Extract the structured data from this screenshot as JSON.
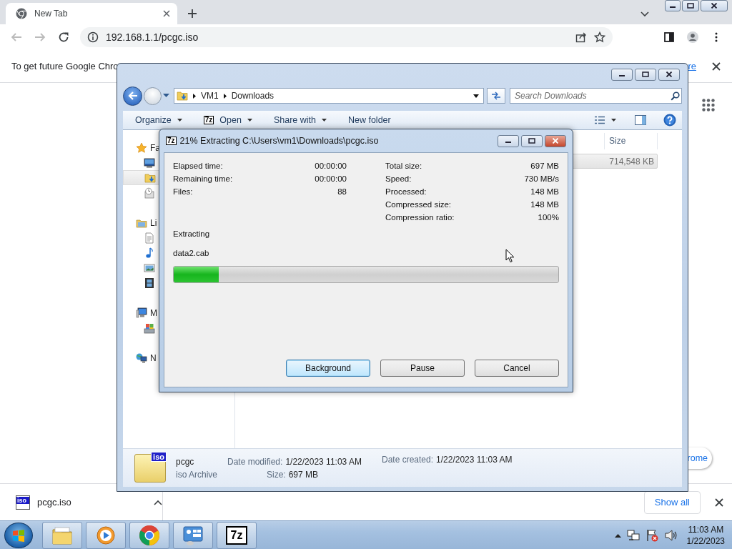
{
  "browser": {
    "tab": {
      "title": "New Tab",
      "selected": true
    },
    "url": "192.168.1.1/pcgc.iso",
    "infobar": {
      "message": "To get future Google Chro",
      "link": "re"
    },
    "content_button": "rome",
    "downloads": {
      "items": [
        {
          "icon_label": "iso",
          "name": "pcgc.iso"
        }
      ],
      "show_all": "Show all"
    }
  },
  "explorer": {
    "breadcrumb": [
      "VM1",
      "Downloads"
    ],
    "search": {
      "placeholder": "Search Downloads"
    },
    "toolbar": [
      {
        "label": "Organize",
        "dropdown": true
      },
      {
        "label": "Open",
        "logo": "7z",
        "dropdown": true
      },
      {
        "label": "Share with",
        "dropdown": true
      },
      {
        "label": "New folder",
        "dropdown": false
      }
    ],
    "nav": [
      {
        "kind": "favorites",
        "label": "Fa",
        "selected": false,
        "children": [
          {
            "kind": "desktop",
            "selected": false
          },
          {
            "kind": "downloads",
            "selected": true
          },
          {
            "kind": "recent",
            "selected": false
          }
        ]
      },
      {
        "kind": "libraries",
        "label": "Li",
        "selected": false,
        "children": [
          {
            "kind": "documents",
            "selected": false
          },
          {
            "kind": "music",
            "selected": false
          },
          {
            "kind": "pictures",
            "selected": false
          },
          {
            "kind": "videos",
            "selected": false
          }
        ]
      },
      {
        "kind": "computer",
        "label": "M",
        "selected": false,
        "children": [
          {
            "kind": "drive",
            "selected": false
          }
        ]
      },
      {
        "kind": "network",
        "label": "N",
        "selected": false
      }
    ],
    "columns": [
      {
        "label": "Size"
      }
    ],
    "rows": [
      {
        "size": "714,548 KB",
        "selected": true
      }
    ],
    "details": {
      "icon_label": "iso",
      "name": "pcgc",
      "type": "iso Archive",
      "fields": [
        {
          "label": "Date modified:",
          "value": "1/22/2023 11:03 AM"
        },
        {
          "label": "Size:",
          "value": "697 MB"
        },
        {
          "label": "Date created:",
          "value": "1/22/2023 11:03 AM"
        }
      ]
    }
  },
  "dialog": {
    "logo": "7z",
    "title": "21% Extracting C:\\Users\\vm1\\Downloads\\pcgc.iso",
    "stats_left": [
      {
        "label": "Elapsed time:",
        "value": "00:00:00"
      },
      {
        "label": "Remaining time:",
        "value": "00:00:00"
      },
      {
        "label": "Files:",
        "value": "88"
      }
    ],
    "stats_right": [
      {
        "label": "Total size:",
        "value": "697 MB"
      },
      {
        "label": "Speed:",
        "value": "730 MB/s"
      },
      {
        "label": "Processed:",
        "value": "148 MB"
      },
      {
        "label": "Compressed size:",
        "value": "148 MB"
      },
      {
        "label": "Compression ratio:",
        "value": "100%"
      }
    ],
    "status": "Extracting",
    "current_file": "data2.cab",
    "progress": {
      "level": 0.117
    },
    "buttons": [
      {
        "label": "Background",
        "focused": true
      },
      {
        "label": "Pause",
        "focused": false
      },
      {
        "label": "Cancel",
        "focused": false
      }
    ]
  },
  "taskbar": {
    "apps": [
      {
        "kind": "explorer"
      },
      {
        "kind": "media"
      },
      {
        "kind": "chrome"
      },
      {
        "kind": "control"
      },
      {
        "kind": "sevenzip",
        "logo": "7z"
      }
    ],
    "clock": {
      "time": "11:03 AM",
      "date": "1/22/2023"
    }
  }
}
